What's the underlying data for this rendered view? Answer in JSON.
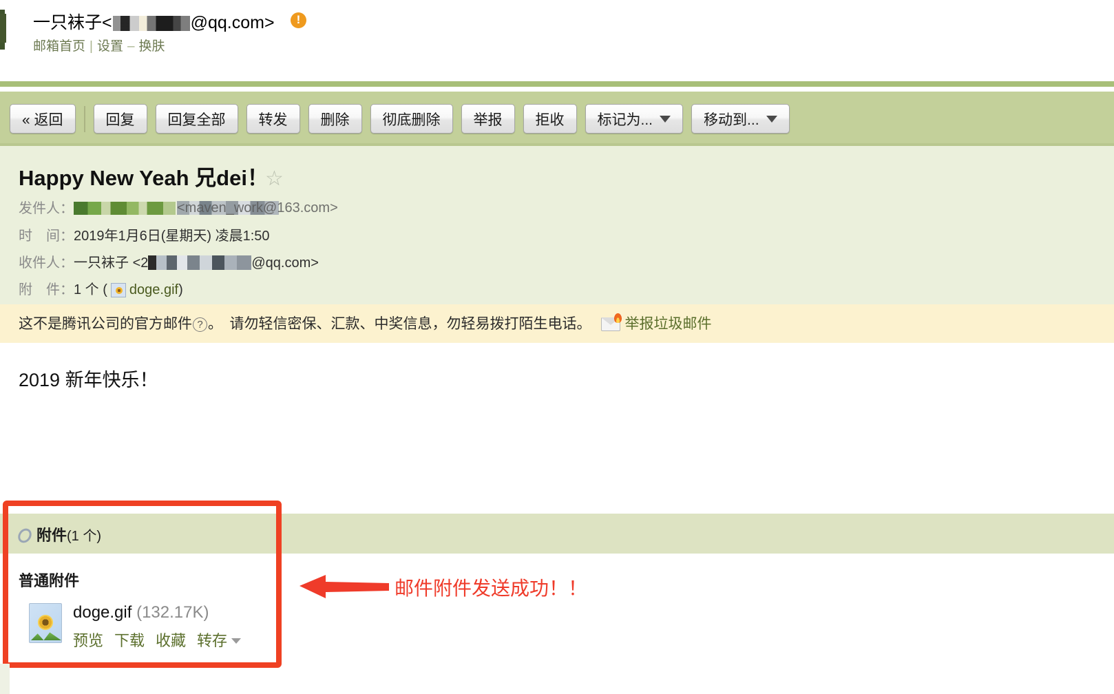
{
  "account": {
    "name": "一只袜子",
    "email_suffix": "@qq.com>",
    "email_prefix": "<",
    "warning_badge": "!",
    "links": {
      "home": "邮箱首页",
      "separator": "|",
      "settings": "设置",
      "dash": "–",
      "skin": "换肤"
    }
  },
  "toolbar": {
    "back": "« 返回",
    "reply": "回复",
    "reply_all": "回复全部",
    "forward": "转发",
    "delete": "删除",
    "delete_forever": "彻底删除",
    "report": "举报",
    "reject": "拒收",
    "mark_as": "标记为...",
    "move_to": "移动到..."
  },
  "mail": {
    "subject": "Happy New Yeah 兄dei！",
    "star_icon": "☆",
    "from_label": "发件人：",
    "from_name_masked": "maven_work",
    "from_address": "<maven_work@163.com>",
    "date_label": "时　间：",
    "date_value": "2019年1月6日(星期天) 凌晨1:50",
    "to_label": "收件人：",
    "to_name": "一只袜子",
    "to_address_prefix": "<2",
    "to_address_suffix": "@qq.com>",
    "attach_label": "附　件：",
    "attach_count": "1 个 (",
    "attach_file": "doge.gif",
    "attach_close": ")"
  },
  "warning": {
    "text_part1": "这不是腾讯公司的官方邮件",
    "help_icon": "?",
    "text_part2": "。　请勿轻信密保、汇款、中奖信息，勿轻易拨打陌生电话。",
    "report_link": "举报垃圾邮件"
  },
  "body": {
    "content": "2019 新年快乐！"
  },
  "attachments": {
    "bar_title": "附件",
    "bar_count": "(1 个)",
    "section_title": "普通附件",
    "file": {
      "name": "doge.gif",
      "size": "(132.17K)",
      "actions": [
        "预览",
        "下载",
        "收藏",
        "转存"
      ]
    }
  },
  "annotation": {
    "text": "邮件附件发送成功！！",
    "color": "#ef3b2a"
  },
  "colors": {
    "toolbar_bg": "#c3d09a",
    "rule_green": "#a8bf78",
    "header_bg": "#ebf0dc",
    "warning_bg": "#fcf2cf",
    "attachment_bar_bg": "#dde3c2",
    "link_green": "#5b6f2c",
    "accent_red": "#ef4123",
    "badge_orange": "#ef9a1e"
  }
}
